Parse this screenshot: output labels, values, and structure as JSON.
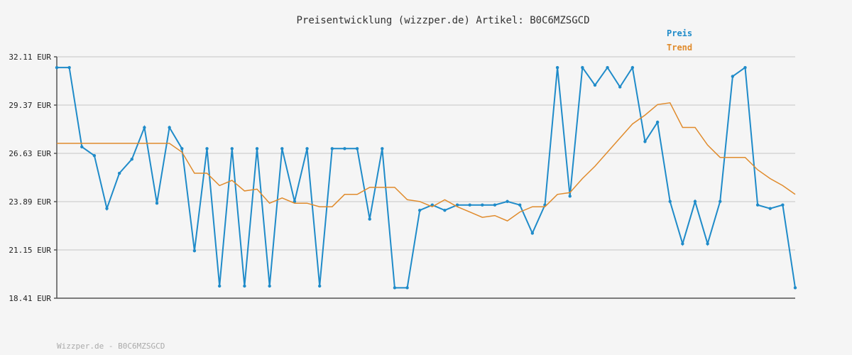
{
  "title": "Preisentwicklung (wizzper.de) Artikel: B0C6MZSGCD",
  "footer": "Wizzper.de - B0C6MZSGCD",
  "chart_data": {
    "type": "line",
    "ylim": [
      18.41,
      32.11
    ],
    "yticks": [
      18.41,
      21.15,
      23.89,
      26.63,
      29.37,
      32.11
    ],
    "ytick_labels": [
      "18.41 EUR",
      "21.15 EUR",
      "23.89 EUR",
      "26.63 EUR",
      "29.37 EUR",
      "32.11 EUR"
    ],
    "grid": true,
    "legend_position": "top-right",
    "series": [
      {
        "name": "Preis",
        "color": "#1f8bc9",
        "markers": true,
        "values": [
          31.5,
          31.5,
          27.0,
          26.5,
          23.5,
          25.5,
          26.3,
          28.1,
          23.8,
          28.1,
          26.9,
          21.1,
          26.9,
          19.1,
          26.9,
          19.1,
          26.9,
          19.1,
          26.9,
          23.9,
          26.9,
          19.1,
          26.9,
          26.9,
          26.9,
          22.9,
          26.9,
          19.0,
          19.0,
          23.4,
          23.7,
          23.4,
          23.7,
          23.7,
          23.7,
          23.7,
          23.9,
          23.7,
          22.1,
          23.7,
          31.5,
          24.2,
          31.5,
          30.5,
          31.5,
          30.4,
          31.5,
          27.3,
          28.4,
          23.9,
          21.5,
          23.9,
          21.5,
          23.9,
          31.0,
          31.5,
          23.7,
          23.5,
          23.7,
          19.0
        ]
      },
      {
        "name": "Trend",
        "color": "#e08b2c",
        "markers": false,
        "values": [
          27.2,
          27.2,
          27.2,
          27.2,
          27.2,
          27.2,
          27.2,
          27.2,
          27.2,
          27.2,
          26.7,
          25.5,
          25.5,
          24.8,
          25.1,
          24.5,
          24.6,
          23.8,
          24.1,
          23.8,
          23.8,
          23.6,
          23.6,
          24.3,
          24.3,
          24.7,
          24.7,
          24.7,
          24.0,
          23.9,
          23.6,
          24.0,
          23.6,
          23.3,
          23.0,
          23.1,
          22.8,
          23.3,
          23.6,
          23.6,
          24.3,
          24.4,
          25.2,
          25.9,
          26.7,
          27.5,
          28.3,
          28.8,
          29.4,
          29.5,
          28.1,
          28.1,
          27.1,
          26.4,
          26.4,
          26.4,
          25.7,
          25.2,
          24.8,
          24.3
        ]
      }
    ]
  }
}
